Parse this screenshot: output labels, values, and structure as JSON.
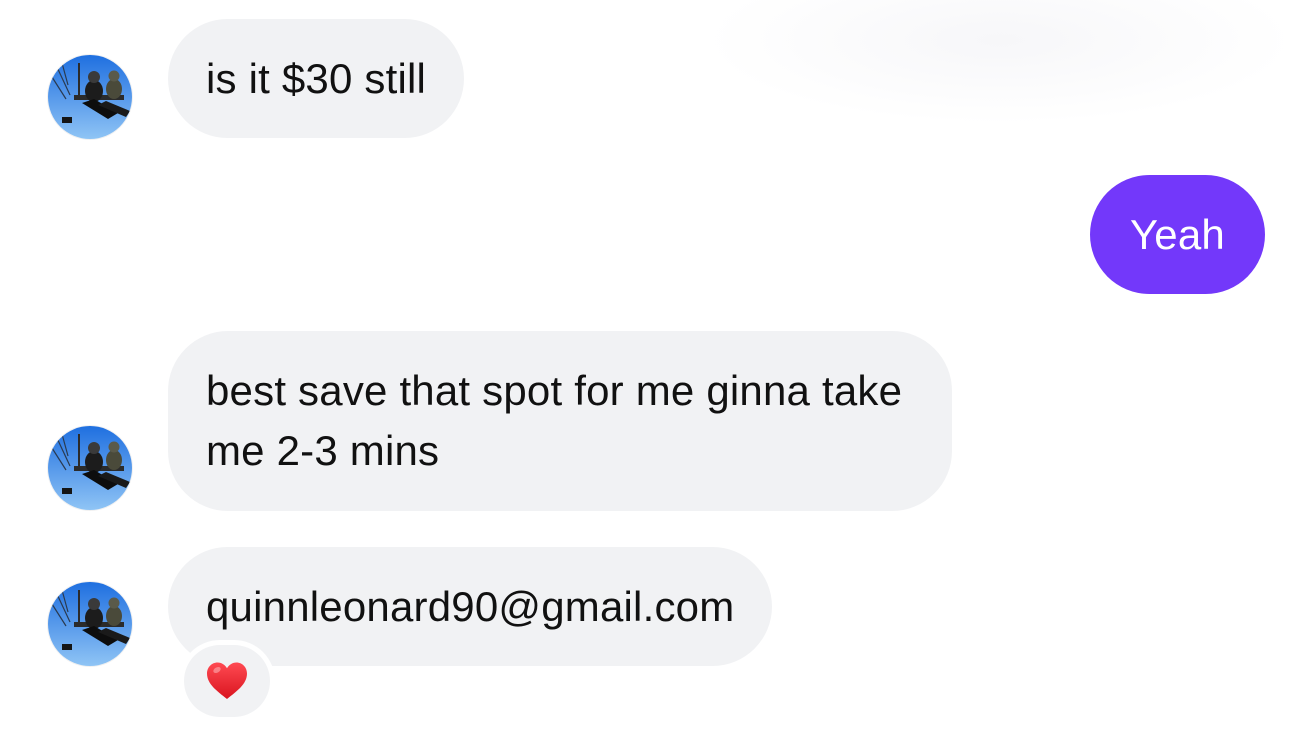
{
  "conversation": {
    "messages": [
      {
        "sender": "other",
        "text": "is it $30 still"
      },
      {
        "sender": "self",
        "text": "Yeah"
      },
      {
        "sender": "other",
        "text": "best save that spot for me ginna take me 2-3 mins",
        "line1": "best save that spot for me ginna take",
        "line2": "me 2-3 mins"
      },
      {
        "sender": "other",
        "text": "quinnleonard90@gmail.com",
        "reaction": "heart-icon"
      }
    ]
  },
  "colors": {
    "incoming_bubble": "#f1f2f4",
    "outgoing_bubble": "#7338fa",
    "reaction_heart": "#e8232f"
  }
}
